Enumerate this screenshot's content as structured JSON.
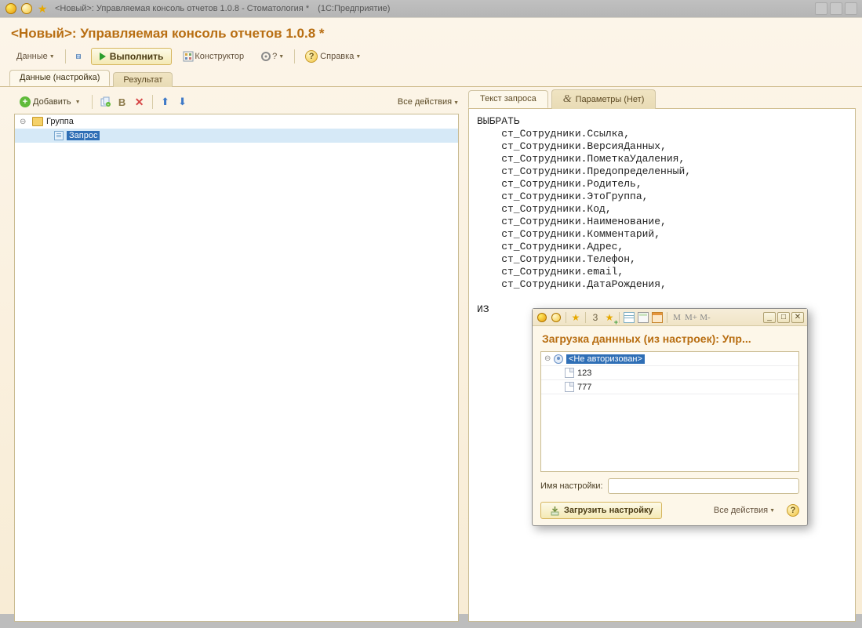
{
  "window": {
    "title_prefix": "<Новый>: Управляемая консоль отчетов 1.0.8 - Стоматология *",
    "title_suffix": "(1С:Предприятие)"
  },
  "page_title": "<Новый>: Управляемая консоль отчетов 1.0.8 *",
  "toolbar": {
    "data": "Данные",
    "execute": "Выполнить",
    "constructor": "Конструктор",
    "help": "Справка",
    "question": "?"
  },
  "tabs": {
    "settings": "Данные (настройка)",
    "result": "Результат"
  },
  "left": {
    "add": "Добавить",
    "all_actions": "Все действия",
    "group": "Группа",
    "query": "Запрос",
    "b": "В"
  },
  "right_tabs": {
    "query_text": "Текст запроса",
    "params": "Параметры (Нет)"
  },
  "code": "ВЫБРАТЬ\n    ст_Сотрудники.Ссылка,\n    ст_Сотрудники.ВерсияДанных,\n    ст_Сотрудники.ПометкаУдаления,\n    ст_Сотрудники.Предопределенный,\n    ст_Сотрудники.Родитель,\n    ст_Сотрудники.ЭтоГруппа,\n    ст_Сотрудники.Код,\n    ст_Сотрудники.Наименование,\n    ст_Сотрудники.Комментарий,\n    ст_Сотрудники.Адрес,\n    ст_Сотрудники.Телефон,\n    ст_Сотрудники.email,\n    ст_Сотрудники.ДатаРождения,\n\nИЗ",
  "dialog": {
    "num": "3",
    "m": "M",
    "mplus": "M+",
    "mminus": "M-",
    "title": "Загрузка даннных (из настроек): Упр...",
    "root": "<Не авторизован>",
    "items": [
      "123",
      "777"
    ],
    "setting_label": "Имя настройки:",
    "setting_value": "",
    "load": "Загрузить настройку",
    "all_actions": "Все действия"
  }
}
